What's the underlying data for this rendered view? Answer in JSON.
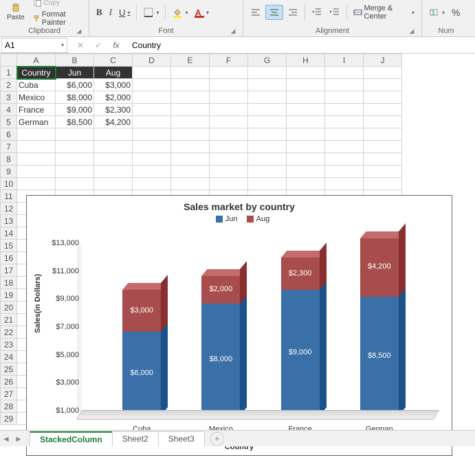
{
  "ribbon": {
    "paste_label": "Paste",
    "copy_label": "Copy",
    "format_painter_label": "Format Painter",
    "clipboard_group": "Clipboard",
    "font_group": "Font",
    "alignment_group": "Alignment",
    "number_group": "Num",
    "merge_center": "Merge & Center",
    "percent": "%",
    "font_buttons": {
      "bold": "B",
      "italic": "I",
      "underline": "U"
    }
  },
  "formula_bar": {
    "cell_ref": "A1",
    "formula_value": "Country",
    "fx": "fx"
  },
  "columns": [
    "A",
    "B",
    "C",
    "D",
    "E",
    "F",
    "G",
    "H",
    "I",
    "J"
  ],
  "rows_visible": 29,
  "table": {
    "headers": [
      "Country",
      "Jun",
      "Aug"
    ],
    "rows": [
      {
        "country": "Cuba",
        "jun": "$6,000",
        "aug": "$3,000"
      },
      {
        "country": "Mexico",
        "jun": "$8,000",
        "aug": "$2,000"
      },
      {
        "country": "France",
        "jun": "$9,000",
        "aug": "$2,300"
      },
      {
        "country": "German",
        "jun": "$8,500",
        "aug": "$4,200"
      }
    ]
  },
  "chart_data": {
    "type": "bar",
    "stacked": true,
    "title": "Sales market by country",
    "xlabel": "Country",
    "ylabel": "Sales(in Dollars)",
    "ylim": [
      1000,
      13000
    ],
    "yticks": [
      "$1,000",
      "$3,000",
      "$5,000",
      "$7,000",
      "$9,000",
      "$11,000",
      "$13,000"
    ],
    "categories": [
      "Cuba",
      "Mexico",
      "France",
      "German"
    ],
    "series": [
      {
        "name": "Jun",
        "color": "#3a6fa8",
        "values": [
          6000,
          8000,
          9000,
          8500
        ],
        "labels": [
          "$6,000",
          "$8,000",
          "$9,000",
          "$8,500"
        ]
      },
      {
        "name": "Aug",
        "color": "#a84d4d",
        "values": [
          3000,
          2000,
          2300,
          4200
        ],
        "labels": [
          "$3,000",
          "$2,000",
          "$2,300",
          "$4,200"
        ]
      }
    ]
  },
  "sheet_tabs": {
    "active": "StackedColumn",
    "tabs": [
      "StackedColumn",
      "Sheet2",
      "Sheet3"
    ]
  }
}
